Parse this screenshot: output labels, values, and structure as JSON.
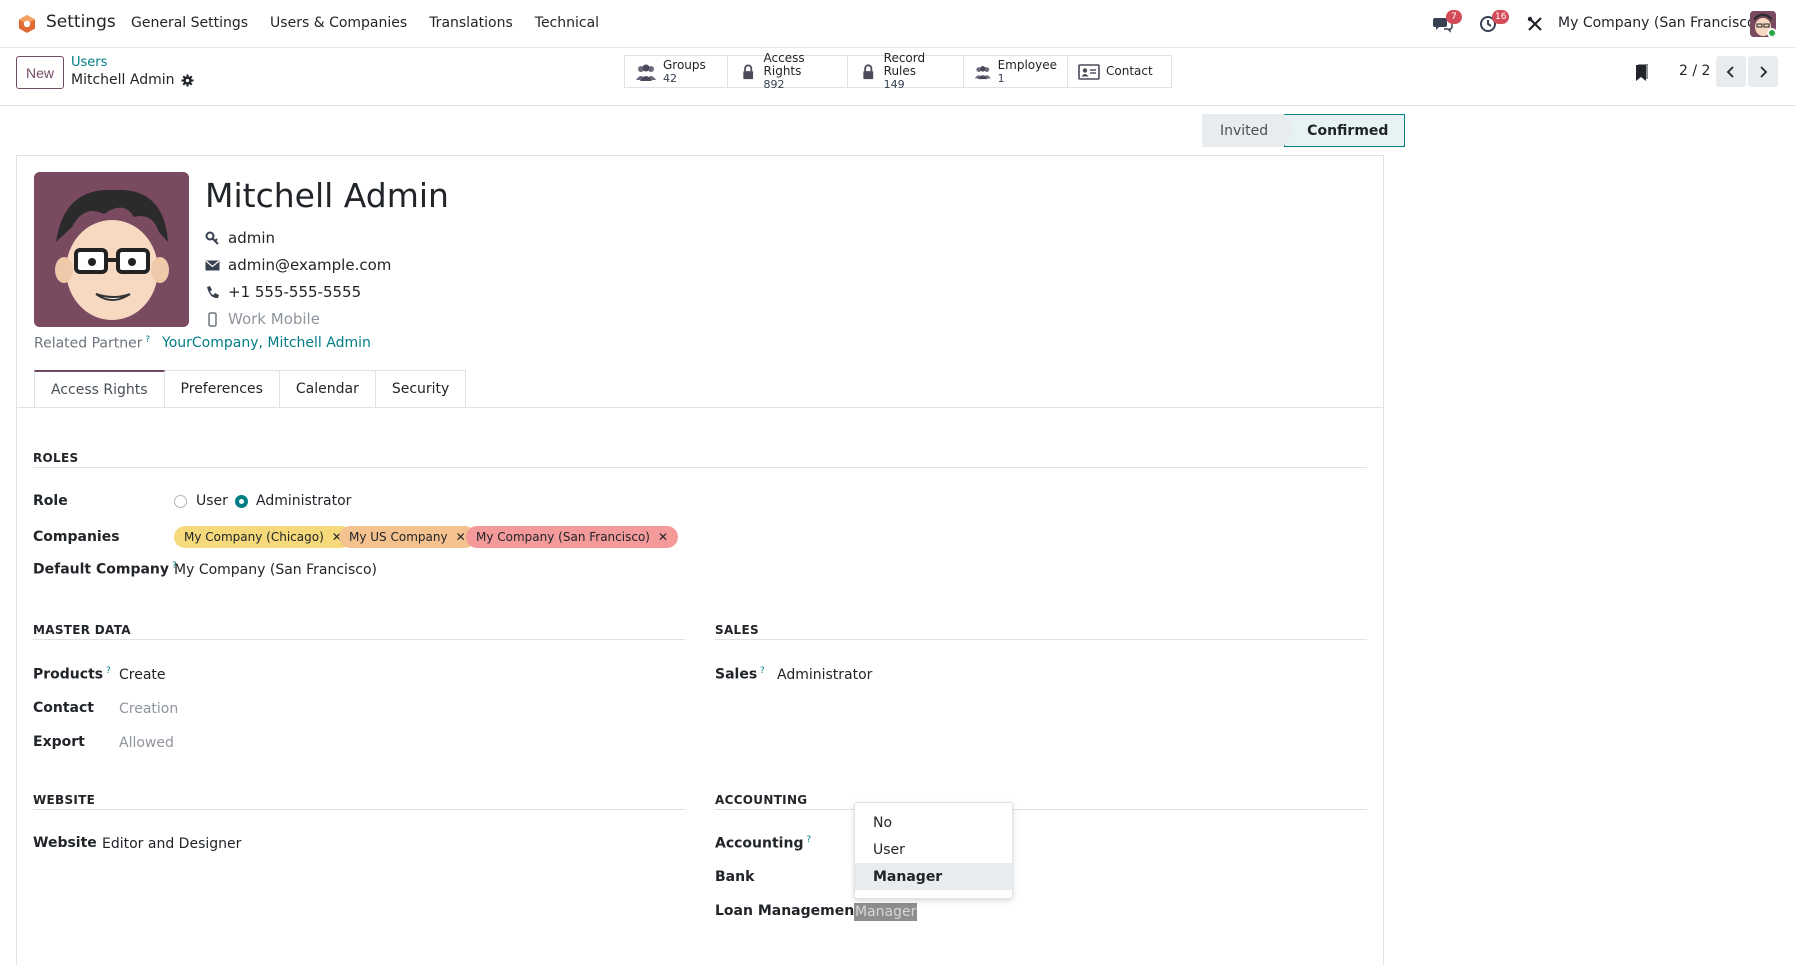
{
  "navbar": {
    "app_name": "Settings",
    "menu": [
      "General Settings",
      "Users & Companies",
      "Translations",
      "Technical"
    ],
    "messages_count": "7",
    "activities_count": "16",
    "company": "My Company (San Francisco)"
  },
  "control": {
    "new_label": "New",
    "breadcrumb_parent": "Users",
    "breadcrumb_current": "Mitchell Admin",
    "pager_value": "2 / 2",
    "smart_buttons": [
      {
        "label": "Groups",
        "value": "42"
      },
      {
        "label": "Access Rights",
        "value": "892"
      },
      {
        "label": "Record Rules",
        "value": "149"
      },
      {
        "label": "Employee",
        "value": "1"
      },
      {
        "label": "Contact",
        "value": ""
      }
    ]
  },
  "status": {
    "steps": [
      "Invited",
      "Confirmed"
    ],
    "active": "Confirmed"
  },
  "user": {
    "name": "Mitchell Admin",
    "login": "admin",
    "email": "admin@example.com",
    "phone": "+1 555-555-5555",
    "mobile_placeholder": "Work Mobile",
    "related_partner_label": "Related Partner",
    "related_partner_value": "YourCompany, Mitchell Admin"
  },
  "tabs": [
    "Access Rights",
    "Preferences",
    "Calendar",
    "Security"
  ],
  "roles": {
    "title": "ROLES",
    "role_label": "Role",
    "role_options": [
      "User",
      "Administrator"
    ],
    "role_selected": "Administrator",
    "companies_label": "Companies",
    "companies": [
      {
        "name": "My Company (Chicago)",
        "color": "#f5d97b"
      },
      {
        "name": "My US Company",
        "color": "#f4c28e"
      },
      {
        "name": "My Company (San Francisco)",
        "color": "#f49a9a"
      }
    ],
    "default_company_label": "Default Company",
    "default_company_value": "My Company (San Francisco)"
  },
  "master_data": {
    "title": "MASTER DATA",
    "products_label": "Products",
    "products_value": "Create",
    "contact_label": "Contact",
    "contact_value": "Creation",
    "export_label": "Export",
    "export_value": "Allowed"
  },
  "sales": {
    "title": "SALES",
    "sales_label": "Sales",
    "sales_value": "Administrator"
  },
  "website": {
    "title": "WEBSITE",
    "website_label": "Website",
    "website_value": "Editor and Designer"
  },
  "accounting": {
    "title": "ACCOUNTING",
    "accounting_label": "Accounting",
    "bank_label": "Bank",
    "loan_label": "Loan Management",
    "loan_value": "Manager",
    "dropdown_options": [
      "No",
      "User",
      "Manager"
    ],
    "dropdown_selected": "Manager"
  },
  "colors": {
    "brand": "#714b67",
    "accent": "#017e84",
    "badge": "#d44c59"
  }
}
